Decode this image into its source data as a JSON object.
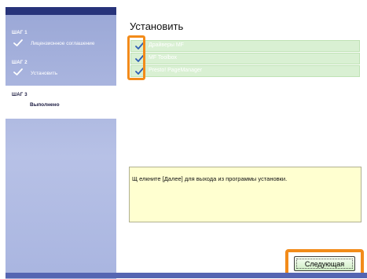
{
  "sidebar": {
    "steps": [
      {
        "number": "ШАГ 1",
        "label": "Лицензионное соглашение",
        "status": "done"
      },
      {
        "number": "ШАГ 2",
        "label": "Установить",
        "status": "done"
      },
      {
        "number": "ШАГ 3",
        "label": "Выполнено",
        "status": "current"
      }
    ]
  },
  "main": {
    "title": "Установить",
    "components": [
      {
        "name": "Драйверы MF",
        "checked": true
      },
      {
        "name": "MF Toolbox",
        "checked": true
      },
      {
        "name": "Presto! PageManager",
        "checked": true
      }
    ],
    "message": "Щ елкните [Далее] для выхода из программы установки."
  },
  "buttons": {
    "next_label": "Следующая"
  },
  "colors": {
    "sidebar_top": "#27337a",
    "sidebar": "#a9b5e0",
    "highlight": "#f28b1a",
    "row_bg": "#d9f0d3",
    "check": "#2f5fb3",
    "message_bg": "#ffffd0"
  }
}
